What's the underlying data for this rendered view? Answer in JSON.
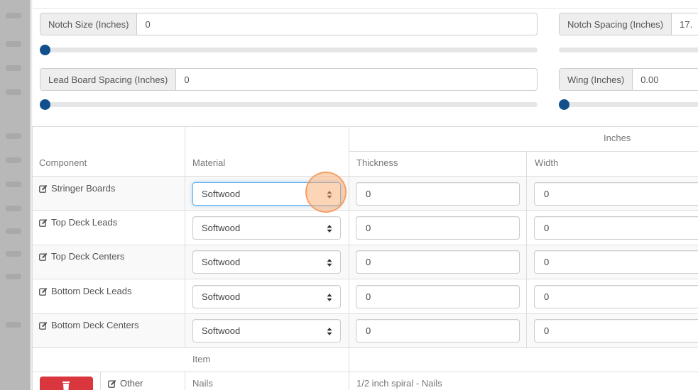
{
  "controls": {
    "notch_size": {
      "label": "Notch Size (Inches)",
      "value": "0",
      "slider_fraction": 0
    },
    "notch_spacing": {
      "label": "Notch Spacing (Inches)",
      "value": "17.",
      "slider_fraction": 0
    },
    "lead_board_spacing": {
      "label": "Lead Board Spacing (Inches)",
      "value": "0",
      "slider_fraction": 0
    },
    "wing": {
      "label": "Wing (Inches)",
      "value": "0.00",
      "slider_fraction": 0
    }
  },
  "table": {
    "group_header": "Inches",
    "headers": {
      "component": "Component",
      "material": "Material",
      "thickness": "Thickness",
      "width": "Width"
    },
    "rows": [
      {
        "component": "Stringer Boards",
        "material": "Softwood",
        "thickness": "0",
        "width": "0"
      },
      {
        "component": "Top Deck Leads",
        "material": "Softwood",
        "thickness": "0",
        "width": "0"
      },
      {
        "component": "Top Deck Centers",
        "material": "Softwood",
        "thickness": "0",
        "width": "0"
      },
      {
        "component": "Bottom Deck Leads",
        "material": "Softwood",
        "thickness": "0",
        "width": "0"
      },
      {
        "component": "Bottom Deck Centers",
        "material": "Softwood",
        "thickness": "0",
        "width": "0"
      }
    ],
    "other": {
      "item_header": "Item",
      "label": "Other",
      "material": "Nails",
      "item": "1/2 inch spiral - Nails"
    }
  },
  "colors": {
    "slider_knob": "#11508c",
    "delete_button": "#d9363e",
    "focus_border": "#66afe9",
    "click_highlight": "#f9aa6e"
  },
  "icons": {
    "edit": "edit-icon",
    "sort": "sort-caret-icon",
    "delete": "trash-icon"
  }
}
